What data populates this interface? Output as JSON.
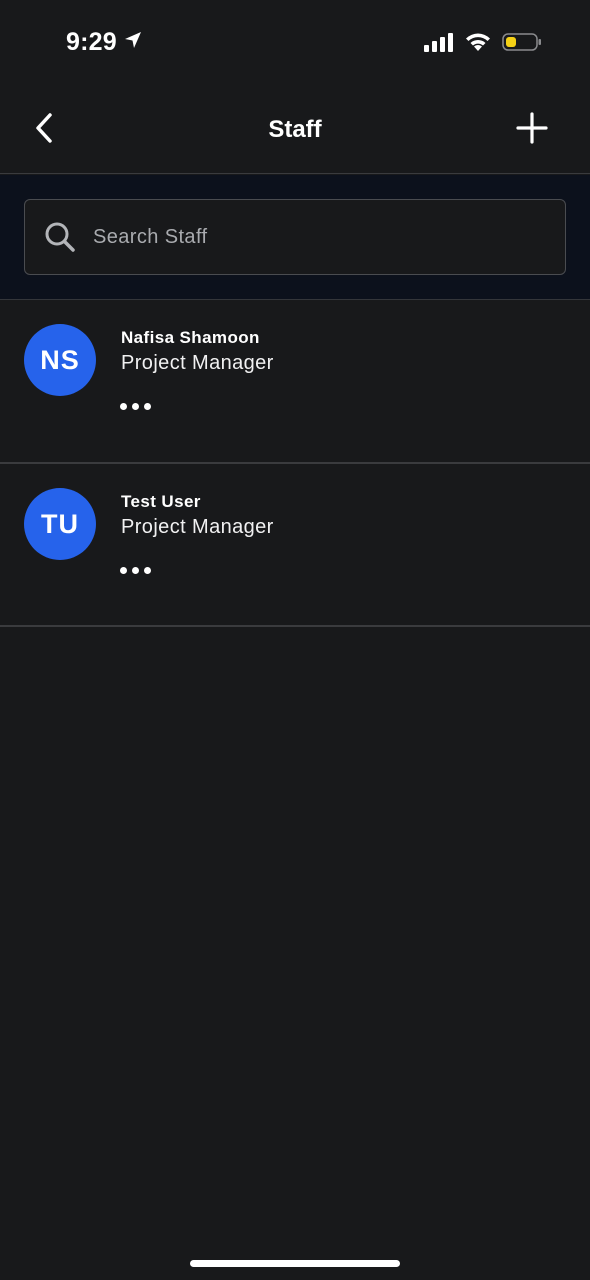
{
  "status_bar": {
    "time": "9:29",
    "icons": [
      "location-arrow-icon",
      "signal-bars-icon",
      "wifi-icon",
      "battery-low-icon"
    ],
    "battery_color": "#f5d116"
  },
  "nav": {
    "title": "Staff",
    "back_icon": "chevron-left-icon",
    "add_icon": "plus-icon"
  },
  "search": {
    "placeholder": "Search Staff",
    "value": ""
  },
  "staff": [
    {
      "initials": "NS",
      "name": "Nafisa Shamoon",
      "role": "Project Manager"
    },
    {
      "initials": "TU",
      "name": "Test User",
      "role": "Project Manager"
    }
  ],
  "colors": {
    "background": "#18191b",
    "search_band": "#0c111c",
    "avatar": "#2663eb"
  }
}
